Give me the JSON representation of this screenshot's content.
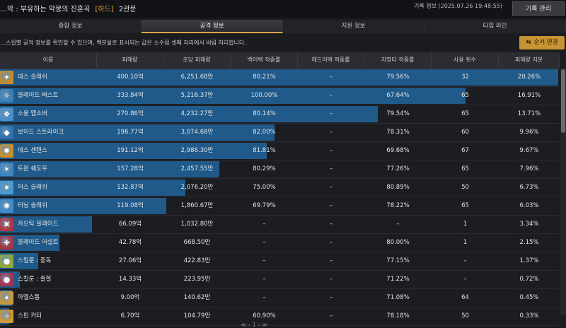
{
  "header": {
    "title_prefix": "…막 : 부유하는 악몽의 진혼곡",
    "difficulty": "[하드]",
    "gate": "2관문",
    "record_info": "기록 정보 (2025.07.26 19:48:55)",
    "record_button": "기록 관리"
  },
  "tabs": [
    {
      "label": "종합 정보",
      "active": false
    },
    {
      "label": "공격 정보",
      "active": true
    },
    {
      "label": "지원 정보",
      "active": false
    },
    {
      "label": "타임 라인",
      "active": false
    }
  ],
  "notice": "…스킬별 공격 정보를 확인할 수 있으며, 백분율로 표시되는 값은 소수점 셋째 자리에서 버림 처리합니다.",
  "order_button": "순서 변경",
  "columns": [
    "이름",
    "피해량",
    "초당 피해량",
    "백어택 적중률",
    "헤드어택 적중률",
    "치명타 적중률",
    "사용 횟수",
    "피해량 지분"
  ],
  "rows": [
    {
      "name": "데스 슬래쉬",
      "damage": "400.10억",
      "dps": "6,251.68만",
      "back": "80.21%",
      "head": "–",
      "crit": "79.56%",
      "uses": "32",
      "share": "20.26%",
      "pct": 100,
      "icon_color": "#c98a2a",
      "icon": "sword-icon",
      "glyph": "✦"
    },
    {
      "name": "블레이드 버스트",
      "damage": "333.84억",
      "dps": "5,216.37만",
      "back": "100.00%",
      "head": "–",
      "crit": "67.64%",
      "uses": "65",
      "share": "16.91%",
      "pct": 83.4,
      "icon_color": "#3a7fb8",
      "icon": "burst-icon",
      "glyph": "✧"
    },
    {
      "name": "소울 앱소버",
      "damage": "270.86억",
      "dps": "4,232.27만",
      "back": "80.14%",
      "head": "–",
      "crit": "79.54%",
      "uses": "65",
      "share": "13.71%",
      "pct": 67.7,
      "icon_color": "#4a8fc8",
      "icon": "soul-icon",
      "glyph": "❖"
    },
    {
      "name": "보이드 스트라이크",
      "damage": "196.77억",
      "dps": "3,074.68만",
      "back": "82.00%",
      "head": "–",
      "crit": "78.31%",
      "uses": "60",
      "share": "9.96%",
      "pct": 49.2,
      "icon_color": "#2f6fae",
      "icon": "void-icon",
      "glyph": "◆"
    },
    {
      "name": "데스 센텐스",
      "damage": "191.12억",
      "dps": "2,986.30만",
      "back": "81.81%",
      "head": "–",
      "crit": "69.68%",
      "uses": "67",
      "share": "9.67%",
      "pct": 47.8,
      "icon_color": "#c9902e",
      "icon": "sentence-icon",
      "glyph": "✹"
    },
    {
      "name": "트윈 쉐도우",
      "damage": "157.28억",
      "dps": "2,457.55만",
      "back": "80.29%",
      "head": "–",
      "crit": "77.26%",
      "uses": "65",
      "share": "7.96%",
      "pct": 39.3,
      "icon_color": "#3d86c2",
      "icon": "shadow-icon",
      "glyph": "✶"
    },
    {
      "name": "어스 슬래쉬",
      "damage": "132.87억",
      "dps": "2,076.20만",
      "back": "75.00%",
      "head": "–",
      "crit": "80.89%",
      "uses": "50",
      "share": "6.73%",
      "pct": 33.2,
      "icon_color": "#4a9ad0",
      "icon": "earth-icon",
      "glyph": "✷"
    },
    {
      "name": "터닝 슬래쉬",
      "damage": "119.08억",
      "dps": "1,860.67만",
      "back": "69.79%",
      "head": "–",
      "crit": "78.22%",
      "uses": "65",
      "share": "6.03%",
      "pct": 29.8,
      "icon_color": "#3f8cc8",
      "icon": "turning-icon",
      "glyph": "✺"
    },
    {
      "name": "카오틱 블레이드",
      "damage": "66.09억",
      "dps": "1,032.80만",
      "back": "–",
      "head": "–",
      "crit": "–",
      "uses": "1",
      "share": "3.34%",
      "pct": 16.5,
      "icon_color": "#b8323a",
      "icon": "chaotic-icon",
      "glyph": "✖"
    },
    {
      "name": "블레이드 어설트",
      "damage": "42.78억",
      "dps": "668.50만",
      "back": "–",
      "head": "–",
      "crit": "80.00%",
      "uses": "1",
      "share": "2.15%",
      "pct": 10.7,
      "icon_color": "#a8323e",
      "icon": "assault-icon",
      "glyph": "✚"
    },
    {
      "name": "스킬룬 : 중독",
      "damage": "27.06억",
      "dps": "422.83만",
      "back": "–",
      "head": "–",
      "crit": "77.15%",
      "uses": "–",
      "share": "1.37%",
      "pct": 6.8,
      "icon_color": "#8fa83a",
      "icon": "poison-rune-icon",
      "glyph": "●"
    },
    {
      "name": "스킬룬 : 출혈",
      "damage": "14.33억",
      "dps": "223.95만",
      "back": "–",
      "head": "–",
      "crit": "71.22%",
      "uses": "–",
      "share": "0.72%",
      "pct": 3.6,
      "icon_color": "#a83050",
      "icon": "bleed-rune-icon",
      "glyph": "●"
    },
    {
      "name": "마엘스톰",
      "damage": "9.00억",
      "dps": "140.62만",
      "back": "–",
      "head": "–",
      "crit": "71.08%",
      "uses": "64",
      "share": "0.45%",
      "pct": 2.2,
      "icon_color": "#c89a3a",
      "icon": "maelstrom-icon",
      "glyph": "✦"
    },
    {
      "name": "스핀 커터",
      "damage": "6.70억",
      "dps": "104.79만",
      "back": "60.90%",
      "head": "–",
      "crit": "78.18%",
      "uses": "50",
      "share": "0.33%",
      "pct": 1.7,
      "icon_color": "#d09a34",
      "icon": "spin-cutter-icon",
      "glyph": "✧"
    }
  ],
  "pager": "≪  ‹      1      ›  ≫"
}
